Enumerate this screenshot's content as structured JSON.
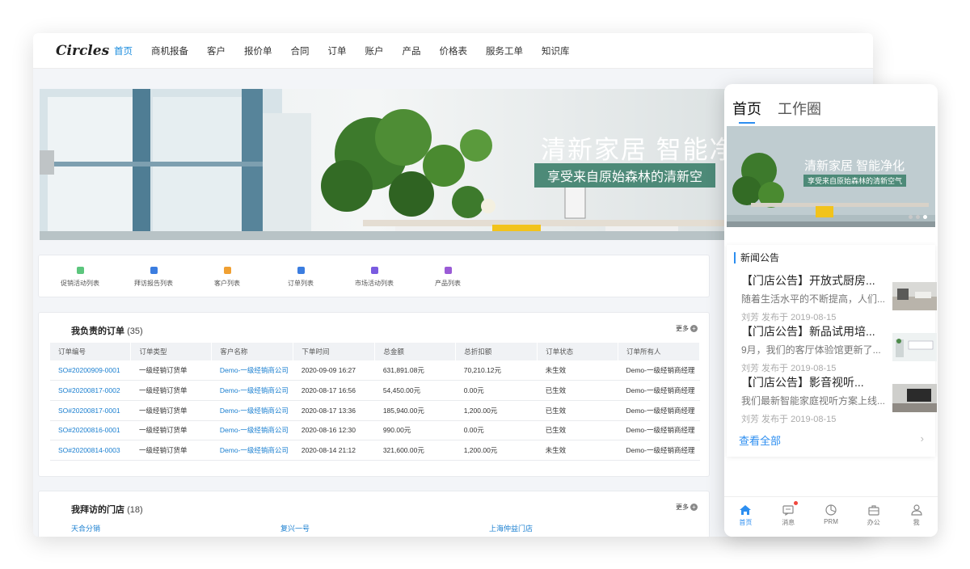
{
  "desktop": {
    "logo": "Circles",
    "nav": [
      "首页",
      "商机报备",
      "客户",
      "报价单",
      "合同",
      "订单",
      "账户",
      "产品",
      "价格表",
      "服务工单",
      "知识库"
    ],
    "banner": {
      "title": "清新家居  智能净",
      "subtitle": "享受来自原始森林的清新空"
    },
    "quick_links": [
      {
        "label": "促销活动列表",
        "color": "#5cc67d"
      },
      {
        "label": "拜访报告列表",
        "color": "#3b7de0"
      },
      {
        "label": "客户列表",
        "color": "#f0a032"
      },
      {
        "label": "订单列表",
        "color": "#3b7de0"
      },
      {
        "label": "市场活动列表",
        "color": "#7a5be0"
      },
      {
        "label": "产品列表",
        "color": "#9a5bd6"
      }
    ],
    "orders": {
      "title": "我负责的订单",
      "count": "(35)",
      "more": "更多",
      "columns": [
        "订单编号",
        "订单类型",
        "客户名称",
        "下单时间",
        "总金额",
        "总折扣额",
        "订单状态",
        "订单所有人"
      ],
      "rows": [
        [
          "SO#20200909-0001",
          "一级经销订货单",
          "Demo-一级经销商公司",
          "2020-09-09 16:27",
          "631,891.08元",
          "70,210.12元",
          "未生效",
          "Demo-一级经销商经理"
        ],
        [
          "SO#20200817-0002",
          "一级经销订货单",
          "Demo-一级经销商公司",
          "2020-08-17 16:56",
          "54,450.00元",
          "0.00元",
          "已生效",
          "Demo-一级经销商经理"
        ],
        [
          "SO#20200817-0001",
          "一级经销订货单",
          "Demo-一级经销商公司",
          "2020-08-17 13:36",
          "185,940.00元",
          "1,200.00元",
          "已生效",
          "Demo-一级经销商经理"
        ],
        [
          "SO#20200816-0001",
          "一级经销订货单",
          "Demo-一级经销商公司",
          "2020-08-16 12:30",
          "990.00元",
          "0.00元",
          "已生效",
          "Demo-一级经销商经理"
        ],
        [
          "SO#20200814-0003",
          "一级经销订货单",
          "Demo-一级经销商公司",
          "2020-08-14 21:12",
          "321,600.00元",
          "1,200.00元",
          "未生效",
          "Demo-一级经销商经理"
        ]
      ]
    },
    "stores": {
      "title": "我拜访的门店",
      "count": "(18)",
      "more": "更多",
      "items": [
        "天合分销",
        "复兴一号",
        "上海仲益门店"
      ]
    }
  },
  "mobile": {
    "tabs": [
      "首页",
      "工作圈"
    ],
    "banner": {
      "title": "清新家居  智能净化",
      "subtitle": "享受来自原始森林的清新空气"
    },
    "news": {
      "title": "新闻公告",
      "items": [
        {
          "title": "【门店公告】开放式厨房...",
          "desc": "随着生活水平的不断提高，人们...",
          "meta": "刘芳  发布于 2019-08-15"
        },
        {
          "title": "【门店公告】新品试用培...",
          "desc": "9月，我们的客厅体验馆更新了...",
          "meta": "刘芳  发布于 2019-08-15"
        },
        {
          "title": "【门店公告】影音视听...",
          "desc": "我们最新智能家庭视听方案上线...",
          "meta": "刘芳  发布于 2019-08-15"
        }
      ],
      "view_all": "查看全部"
    },
    "bottom_nav": [
      {
        "label": "首页",
        "icon": "home-icon"
      },
      {
        "label": "消息",
        "icon": "message-icon"
      },
      {
        "label": "PRM",
        "icon": "chart-icon"
      },
      {
        "label": "办公",
        "icon": "briefcase-icon"
      },
      {
        "label": "我",
        "icon": "user-icon"
      }
    ]
  }
}
